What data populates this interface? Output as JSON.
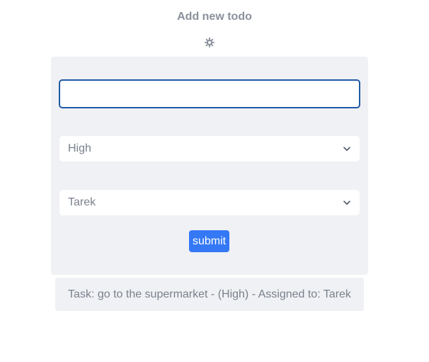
{
  "header": {
    "title": "Add new todo",
    "settings_icon": "gear-icon"
  },
  "form": {
    "task_input": {
      "value": "",
      "placeholder": ""
    },
    "priority_select": {
      "selected": "High",
      "icon": "chevron-down-icon"
    },
    "assignee_select": {
      "selected": "Tarek",
      "icon": "chevron-down-icon"
    },
    "submit_label": "submit"
  },
  "todos": [
    {
      "text": "Task: go to the supermarket - (High) - Assigned to: Tarek"
    }
  ],
  "colors": {
    "accent": "#3478f6",
    "input_border": "#1f5aa6",
    "card_bg": "#f0f1f4",
    "muted_text": "#7a818c"
  }
}
